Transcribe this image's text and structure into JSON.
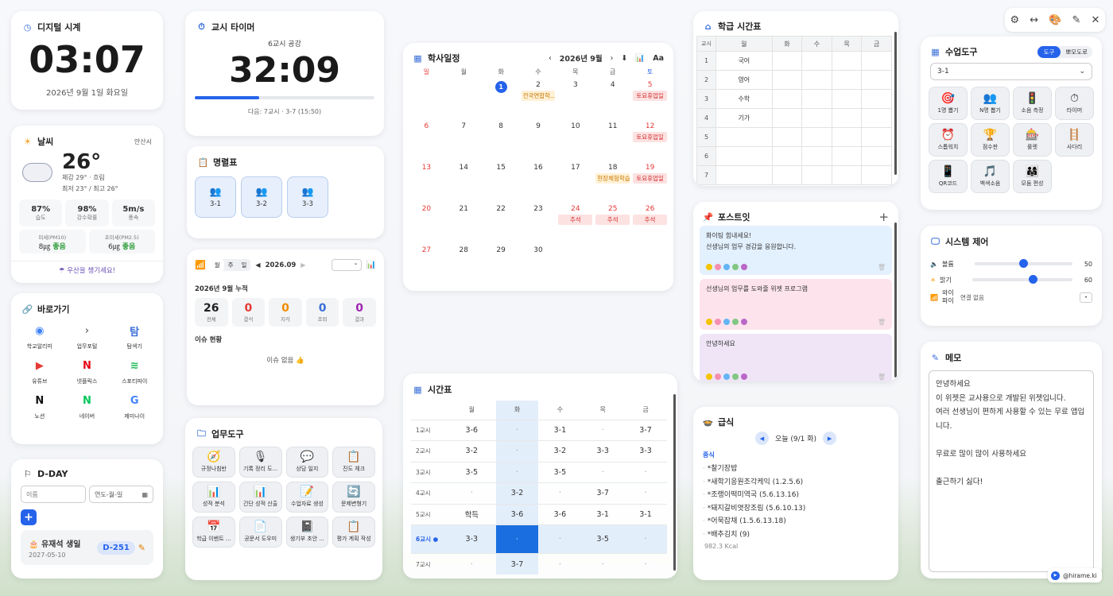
{
  "clock": {
    "title": "디지털 시계",
    "time": "03:07",
    "date": "2026년 9월 1일 화요일"
  },
  "weather": {
    "title": "날씨",
    "location": "안산시",
    "temp": "26°",
    "feels": "체감 29° · 흐림",
    "range": "최저 23° / 최고 26°",
    "stats": [
      {
        "v": "87%",
        "l": "습도"
      },
      {
        "v": "98%",
        "l": "강수확률"
      },
      {
        "v": "5m/s",
        "l": "풍속"
      }
    ],
    "dust": [
      {
        "l": "미세(PM10)",
        "v": "8㎍",
        "s": "좋음"
      },
      {
        "l": "초미세(PM2.5)",
        "v": "6㎍",
        "s": "좋음"
      }
    ],
    "tip": "☂ 우산을 챙기세요!"
  },
  "shortcuts": {
    "title": "바로가기",
    "items": [
      {
        "l": "학교알리미",
        "g": "◉",
        "c": "#3b82f6"
      },
      {
        "l": "업무포털",
        "g": "›",
        "c": "#777"
      },
      {
        "l": "탐색기",
        "g": "탐",
        "c": "#3a6fd8"
      },
      {
        "l": "유튜브",
        "g": "▶",
        "c": "#e53935"
      },
      {
        "l": "넷플릭스",
        "g": "N",
        "c": "#e50914"
      },
      {
        "l": "스포티파이",
        "g": "≋",
        "c": "#1db954"
      },
      {
        "l": "노션",
        "g": "N",
        "c": "#111"
      },
      {
        "l": "네이버",
        "g": "N",
        "c": "#03c75a"
      },
      {
        "l": "제미나이",
        "g": "G",
        "c": "#4285f4"
      }
    ]
  },
  "dday": {
    "title": "D-DAY",
    "name_ph": "이름",
    "date_ph": "연도-월-일",
    "add": "+",
    "item_name": "유재석 생일",
    "item_date": "2027-05-10",
    "item_badge": "D-251"
  },
  "timer": {
    "title": "교시 타이머",
    "label": "6교시 공강",
    "time": "32:09",
    "next": "다음: 7교시 · 3-7 (15:50)",
    "progress": 0.36
  },
  "roster": {
    "title": "명렬표",
    "classes": [
      "3-1",
      "3-2",
      "3-3"
    ]
  },
  "attend": {
    "tabs": [
      "월",
      "주",
      "일"
    ],
    "period": "2026.09",
    "summary": "2026년 9월 누적",
    "stats": [
      {
        "v": "26",
        "l": "전체",
        "c": "#222"
      },
      {
        "v": "0",
        "l": "결석",
        "c": "#e53935"
      },
      {
        "v": "0",
        "l": "지각",
        "c": "#f08c00"
      },
      {
        "v": "0",
        "l": "조퇴",
        "c": "#3a6fd8"
      },
      {
        "v": "0",
        "l": "결과",
        "c": "#9c27b0"
      }
    ],
    "issue_title": "이슈 현황",
    "issue_empty": "이슈 없음 👍"
  },
  "worktools": {
    "title": "업무도구",
    "items": [
      {
        "l": "규정나침반",
        "g": "🧭"
      },
      {
        "l": "기록 정리 도...",
        "g": "🎙"
      },
      {
        "l": "상담 일지",
        "g": "💬"
      },
      {
        "l": "진도 체크",
        "g": "📋"
      },
      {
        "l": "성적 분석",
        "g": "📊"
      },
      {
        "l": "간단 성적 산출",
        "g": "📊"
      },
      {
        "l": "수업자료 생성",
        "g": "📝"
      },
      {
        "l": "문제변형기",
        "g": "🔄"
      },
      {
        "l": "학급 이벤트 ...",
        "g": "📅"
      },
      {
        "l": "공문서 도우미",
        "g": "📄"
      },
      {
        "l": "생기부 초안 ...",
        "g": "📓"
      },
      {
        "l": "평가 계획 작성",
        "g": "📋"
      }
    ]
  },
  "calendar": {
    "title": "학사일정",
    "month": "2026년 9월",
    "prev": "‹",
    "next": "›",
    "font_btn": "Aa",
    "weekdays": [
      "일",
      "월",
      "화",
      "수",
      "목",
      "금",
      "토"
    ],
    "weeks": [
      [
        {
          "d": ""
        },
        {
          "d": ""
        },
        {
          "d": "1",
          "today": true
        },
        {
          "d": "2",
          "ev": [
            "전국연합학..."
          ],
          "evc": "y"
        },
        {
          "d": "3"
        },
        {
          "d": "4"
        },
        {
          "d": "5",
          "ev": [
            "토요휴업일"
          ]
        }
      ],
      [
        {
          "d": "6"
        },
        {
          "d": "7"
        },
        {
          "d": "8"
        },
        {
          "d": "9"
        },
        {
          "d": "10"
        },
        {
          "d": "11"
        },
        {
          "d": "12",
          "ev": [
            "토요휴업일"
          ]
        }
      ],
      [
        {
          "d": "13"
        },
        {
          "d": "14"
        },
        {
          "d": "15"
        },
        {
          "d": "16"
        },
        {
          "d": "17"
        },
        {
          "d": "18",
          "ev": [
            "현장체험학습"
          ],
          "evc": "y"
        },
        {
          "d": "19",
          "ev": [
            "토요휴업일"
          ]
        }
      ],
      [
        {
          "d": "20"
        },
        {
          "d": "21"
        },
        {
          "d": "22"
        },
        {
          "d": "23"
        },
        {
          "d": "24",
          "ev": [
            "추석"
          ]
        },
        {
          "d": "25",
          "ev": [
            "추석"
          ]
        },
        {
          "d": "26",
          "ev": [
            "추석"
          ]
        }
      ],
      [
        {
          "d": "27"
        },
        {
          "d": "28"
        },
        {
          "d": "29"
        },
        {
          "d": "30"
        },
        {
          "d": ""
        },
        {
          "d": ""
        },
        {
          "d": ""
        }
      ]
    ]
  },
  "timetable": {
    "title": "시간표",
    "days": [
      "월",
      "화",
      "수",
      "목",
      "금"
    ],
    "rows": [
      {
        "p": "1교시",
        "c": [
          "3-6",
          "·",
          "3-1",
          "·",
          "3-7"
        ]
      },
      {
        "p": "2교시",
        "c": [
          "3-2",
          "·",
          "3-2",
          "3-3",
          "3-3"
        ]
      },
      {
        "p": "3교시",
        "c": [
          "3-5",
          "·",
          "3-5",
          "·",
          "·"
        ]
      },
      {
        "p": "4교시",
        "c": [
          "·",
          "3-2",
          "·",
          "3-7",
          "·"
        ]
      },
      {
        "p": "5교시",
        "c": [
          "학득",
          "3-6",
          "3-6",
          "3-1",
          "3-1"
        ]
      },
      {
        "p": "6교시 ●",
        "c": [
          "3-3",
          "·",
          "·",
          "3-5",
          "·"
        ],
        "cur": true
      },
      {
        "p": "7교시",
        "c": [
          "·",
          "3-7",
          "·",
          "·",
          "·"
        ]
      }
    ]
  },
  "classsched": {
    "title": "학급 시간표",
    "head": [
      "교시",
      "월",
      "화",
      "수",
      "목",
      "금"
    ],
    "rows": [
      [
        "1",
        "국어"
      ],
      [
        "2",
        "영어"
      ],
      [
        "3",
        "수학"
      ],
      [
        "4",
        "기가"
      ],
      [
        "5",
        ""
      ],
      [
        "6",
        ""
      ],
      [
        "7",
        ""
      ]
    ]
  },
  "postit": {
    "title": "포스트잇",
    "add": "+",
    "notes": [
      {
        "text": "화이팅 힘내세요!\n선생님의 업무 경감을 응원합니다.",
        "bg": "#e3f0fd"
      },
      {
        "text": "선생님의 업무를 도와줄 위젯 프로그램",
        "bg": "#fde4ec"
      },
      {
        "text": "안녕하세요",
        "bg": "#efe5f7"
      }
    ]
  },
  "meal": {
    "title": "급식",
    "date": "오늘 (9/1 화)",
    "type": "중식",
    "items": [
      "*찰기장밥",
      "*새학기응원조각케익 (1.2.5.6)",
      "*조랭이떡미역국 (5.6.13.16)",
      "*돼지갈비엿장조림 (5.6.10.13)",
      "*어묵잡채 (1.5.6.13.18)",
      "*배추김치 (9)"
    ],
    "kcal": "982.3 Kcal"
  },
  "classtools": {
    "title": "수업도구",
    "tab1": "도구",
    "tab2": "뽀모도로",
    "select": "3-1",
    "items": [
      {
        "l": "1명 뽑기",
        "g": "🎯"
      },
      {
        "l": "N명 뽑기",
        "g": "👥"
      },
      {
        "l": "소음 측정",
        "g": "🚦"
      },
      {
        "l": "타이머",
        "g": "⏱"
      },
      {
        "l": "스톱워치",
        "g": "⏰"
      },
      {
        "l": "점수판",
        "g": "🏆"
      },
      {
        "l": "룰렛",
        "g": "🎰"
      },
      {
        "l": "사다리",
        "g": "🪜"
      },
      {
        "l": "QR코드",
        "g": "📱"
      },
      {
        "l": "백색소음",
        "g": "🎵"
      },
      {
        "l": "모둠 편성",
        "g": "👨‍👩‍👧"
      }
    ]
  },
  "system": {
    "title": "시스템 제어",
    "volume_l": "볼륨",
    "volume_v": "50",
    "volume": 0.5,
    "bright_l": "밝기",
    "bright_v": "60",
    "bright": 0.6,
    "wifi_l": "와이파이",
    "wifi_v": "연결 없음"
  },
  "memo": {
    "title": "메모",
    "text": "안녕하세요\n이 위젯은 교사용으로 개발된 위젯입니다.\n여러 선생님이 편하게 사용할 수 있는 무료 앱입니다.\n\n무료로 많이 많이 사용하세요\n\n출근하기 싫다!"
  },
  "credit": "@hirame.ki"
}
